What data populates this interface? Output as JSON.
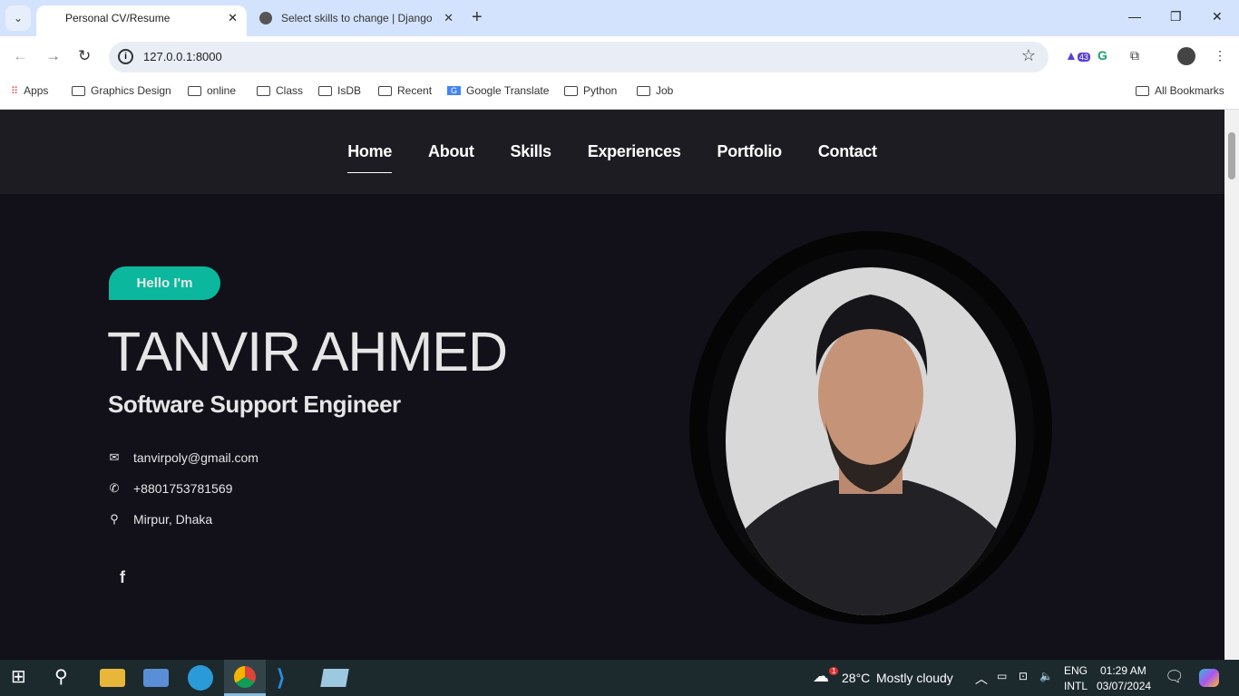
{
  "browser": {
    "tabs": [
      {
        "title": "Personal CV/Resume",
        "active": true
      },
      {
        "title": "Select skills to change | Django",
        "active": false
      }
    ],
    "url": "127.0.0.1:8000",
    "extension_badge": "43",
    "bookmarks": [
      "Apps",
      "Graphics Design",
      "online",
      "Class",
      "IsDB",
      "Recent",
      "Google Translate",
      "Python",
      "Job"
    ],
    "all_bookmarks": "All Bookmarks"
  },
  "site": {
    "nav": [
      "Home",
      "About",
      "Skills",
      "Experiences",
      "Portfolio",
      "Contact"
    ],
    "greeting": "Hello I'm",
    "name": "TANVIR AHMED",
    "role": "Software Support Engineer",
    "email": "tanvirpoly@gmail.com",
    "phone": "+8801753781569",
    "location": "Mirpur, Dhaka",
    "accent": "#0bb89d"
  },
  "taskbar": {
    "weather_temp": "28°C",
    "weather_desc": "Mostly cloudy",
    "weather_badge": "1",
    "lang1": "ENG",
    "lang2": "INTL",
    "time": "01:29 AM",
    "date": "03/07/2024"
  }
}
